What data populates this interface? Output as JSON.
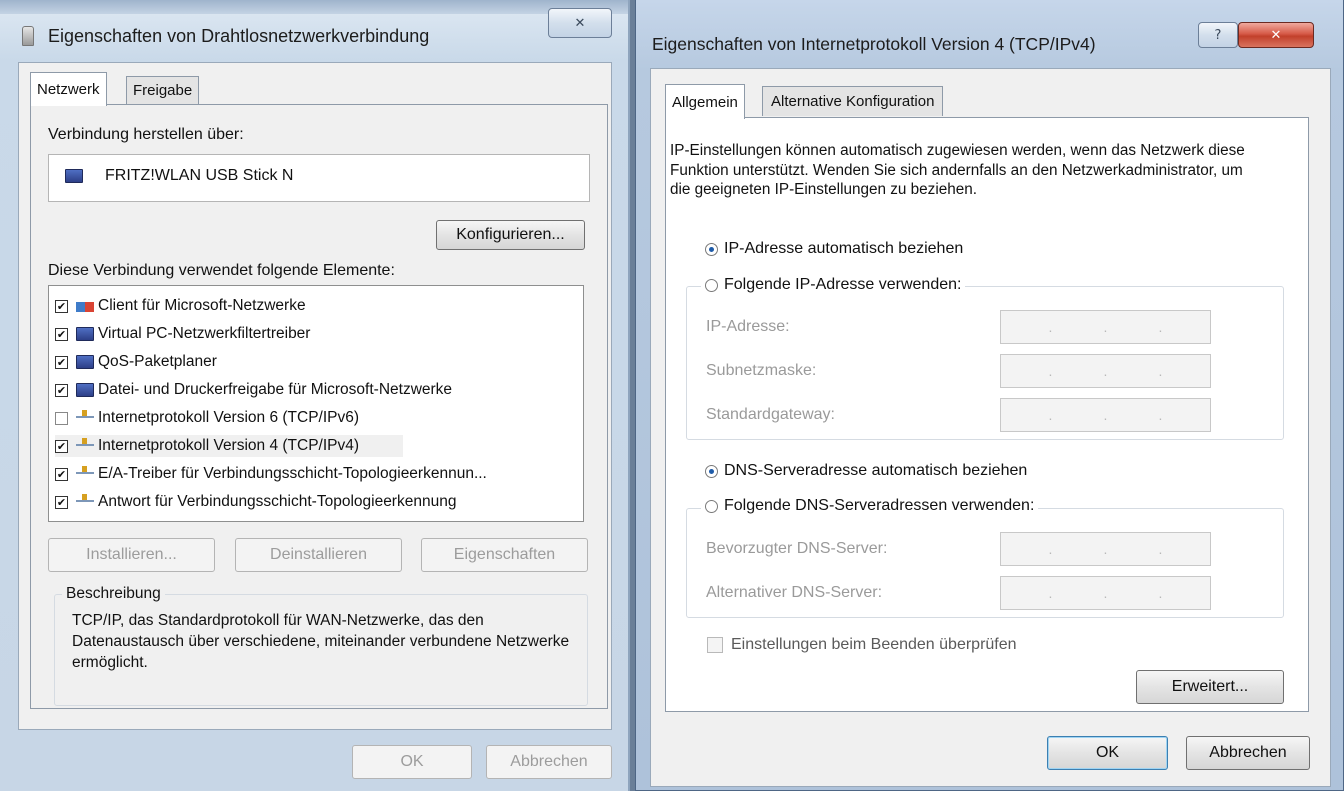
{
  "left_dialog": {
    "title": "Eigenschaften von Drahtlosnetzwerkverbindung",
    "close_glyph": "✕",
    "tabs": [
      {
        "label": "Netzwerk"
      },
      {
        "label": "Freigabe"
      }
    ],
    "connect_via_label": "Verbindung herstellen über:",
    "adapter_name": "FRITZ!WLAN USB Stick N",
    "configure_button": "Konfigurieren...",
    "elements_label": "Diese Verbindung verwendet folgende Elemente:",
    "items": [
      {
        "label": "Client für Microsoft-Netzwerke",
        "checked": true,
        "icon": "client-icon"
      },
      {
        "label": "Virtual PC-Netzwerkfiltertreiber",
        "checked": true,
        "icon": "service-icon"
      },
      {
        "label": "QoS-Paketplaner",
        "checked": true,
        "icon": "service-icon"
      },
      {
        "label": "Datei- und Druckerfreigabe für Microsoft-Netzwerke",
        "checked": true,
        "icon": "service-icon"
      },
      {
        "label": "Internetprotokoll Version 6 (TCP/IPv6)",
        "checked": false,
        "icon": "protocol-icon"
      },
      {
        "label": "Internetprotokoll Version 4 (TCP/IPv4)",
        "checked": true,
        "icon": "protocol-icon"
      },
      {
        "label": "E/A-Treiber für Verbindungsschicht-Topologieerkennun...",
        "checked": true,
        "icon": "protocol-icon"
      },
      {
        "label": "Antwort für Verbindungsschicht-Topologieerkennung",
        "checked": true,
        "icon": "protocol-icon"
      }
    ],
    "install_button": "Installieren...",
    "uninstall_button": "Deinstallieren",
    "properties_button": "Eigenschaften",
    "description_title": "Beschreibung",
    "description_text": "TCP/IP, das Standardprotokoll für WAN-Netzwerke, das den Datenaustausch über verschiedene, miteinander verbundene Netzwerke ermöglicht.",
    "ok_button": "OK",
    "cancel_button": "Abbrechen"
  },
  "right_dialog": {
    "title": "Eigenschaften von Internetprotokoll Version 4 (TCP/IPv4)",
    "help_glyph": "?",
    "close_glyph": "✕",
    "tabs": [
      {
        "label": "Allgemein"
      },
      {
        "label": "Alternative Konfiguration"
      }
    ],
    "description": "IP-Einstellungen können automatisch zugewiesen werden, wenn das Netzwerk diese Funktion unterstützt. Wenden Sie sich andernfalls an den Netzwerkadministrator, um die geeigneten IP-Einstellungen zu beziehen.",
    "ip_auto_label": "IP-Adresse automatisch beziehen",
    "ip_manual_label": "Folgende IP-Adresse verwenden:",
    "ip_address_label": "IP-Adresse:",
    "subnet_label": "Subnetzmaske:",
    "gateway_label": "Standardgateway:",
    "dns_auto_label": "DNS-Serveradresse automatisch beziehen",
    "dns_manual_label": "Folgende DNS-Serveradressen verwenden:",
    "preferred_dns_label": "Bevorzugter DNS-Server:",
    "alternate_dns_label": "Alternativer DNS-Server:",
    "validate_label": "Einstellungen beim Beenden überprüfen",
    "advanced_button": "Erweitert...",
    "ok_button": "OK",
    "cancel_button": "Abbrechen",
    "ip_auto_selected": true,
    "dns_auto_selected": true
  }
}
